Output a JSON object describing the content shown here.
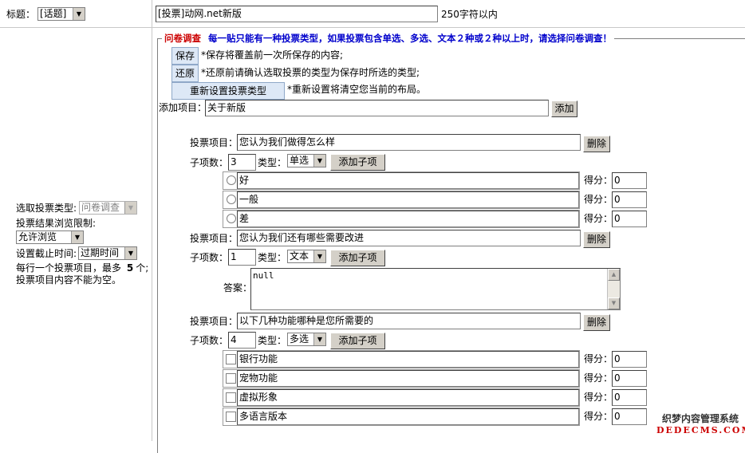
{
  "title_row": {
    "label": "标题：",
    "topic_select": "[话题]",
    "title_value": "[投票]动网.net新版",
    "limit_note": "250字符以内"
  },
  "sidebar": {
    "vote_type_label": "选取投票类型:",
    "vote_type_value": "问卷调查",
    "result_limit_label": "投票结果浏览限制:",
    "result_limit_value": "允许浏览",
    "deadline_label": "设置截止时间:",
    "deadline_value": "过期时间",
    "hint_line1": "每行一个投票项目，最多",
    "hint_max": "5",
    "hint_line1_end": "个;",
    "hint_line2": "投票项目内容不能为空。"
  },
  "panel": {
    "legend_name": "问卷调查",
    "legend_desc": "每一贴只能有一种投票类型，如果投票包含单选、多选、文本２种或２种以上时，请选择问卷调查！",
    "save_button": "保存",
    "save_note": "*保存将覆盖前一次所保存的内容;",
    "restore_button": "还原",
    "restore_note": "*还原前请确认选取投票的类型为保存时所选的类型;",
    "reset_button": "重新设置投票类型",
    "reset_note": "*重新设置将清空您当前的布局。",
    "add_item_label": "添加项目：",
    "add_item_value": "关于新版",
    "add_button": "添加"
  },
  "labels": {
    "item": "投票项目：",
    "delete": "删除",
    "sub_count": "子项数：",
    "type": "类型：",
    "add_sub": "添加子项",
    "score": "得分：",
    "answer": "答案："
  },
  "items": [
    {
      "question": "您认为我们做得怎么样",
      "count": "3",
      "type": "单选",
      "options": [
        {
          "text": "好",
          "score": "0"
        },
        {
          "text": "一般",
          "score": "0"
        },
        {
          "text": "差",
          "score": "0"
        }
      ]
    },
    {
      "question": "您认为我们还有哪些需要改进",
      "count": "1",
      "type": "文本",
      "answer": "null"
    },
    {
      "question": "以下几种功能哪种是您所需要的",
      "count": "4",
      "type": "多选",
      "options": [
        {
          "text": "银行功能",
          "score": "0"
        },
        {
          "text": "宠物功能",
          "score": "0"
        },
        {
          "text": "虚拟形象",
          "score": "0"
        },
        {
          "text": "多语言版本",
          "score": "0"
        }
      ]
    }
  ],
  "watermark": {
    "line1": "织梦内容管理系统",
    "line2": "DEDECMS.COM"
  },
  "colors": {
    "legend_red": "#cc0000",
    "legend_blue": "#0000cc",
    "blue_button": "#dde8f6"
  }
}
